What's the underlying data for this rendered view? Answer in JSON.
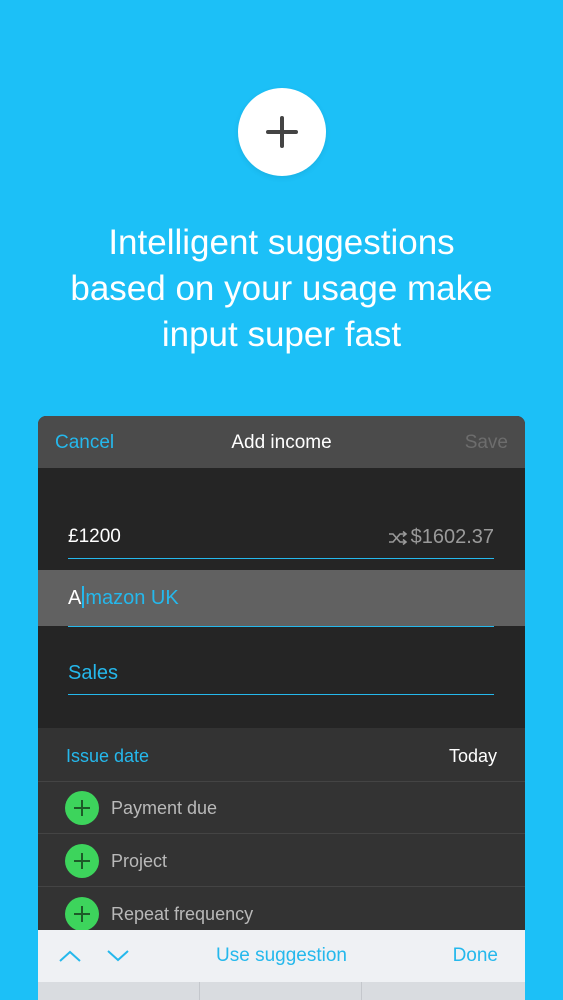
{
  "hero": {
    "headline_lines": [
      "Intelligent suggestions",
      "based on your usage make",
      "input super fast"
    ]
  },
  "nav": {
    "cancel_label": "Cancel",
    "title": "Add income",
    "save_label": "Save"
  },
  "form": {
    "amount": "£1200",
    "converted_amount": "$1602.37",
    "payer_typed": "A",
    "payer_suggestion": "mazon UK",
    "category": "Sales",
    "issue_date_label": "Issue date",
    "issue_date_value": "Today",
    "optional_fields": [
      {
        "label": "Payment due"
      },
      {
        "label": "Project"
      },
      {
        "label": "Repeat frequency"
      }
    ]
  },
  "toolbar": {
    "use_suggestion_label": "Use suggestion",
    "done_label": "Done"
  },
  "colors": {
    "background": "#1cc0f7",
    "accent": "#25b8ec",
    "add_green": "#3dd45c"
  }
}
